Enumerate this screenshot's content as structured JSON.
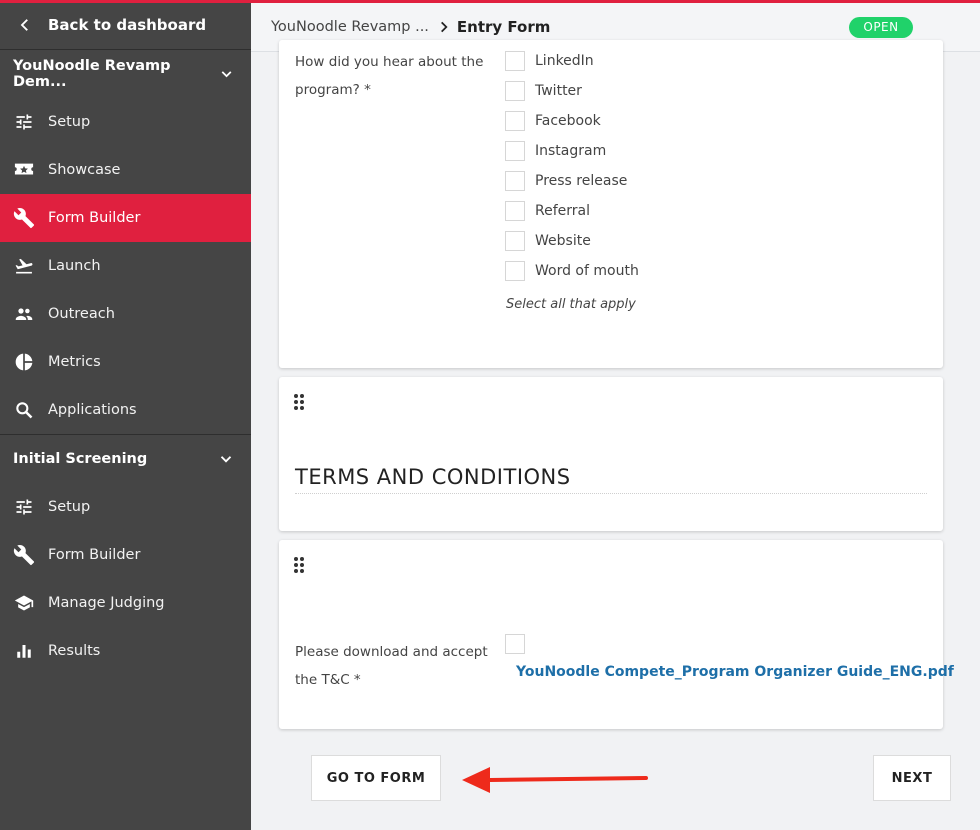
{
  "sidebar": {
    "back_label": "Back to dashboard",
    "program_title": "YouNoodle Revamp Dem...",
    "program_items": [
      {
        "label": "Setup",
        "icon": "tune-icon"
      },
      {
        "label": "Showcase",
        "icon": "showcase-icon"
      },
      {
        "label": "Form Builder",
        "icon": "wrench-icon",
        "active": true
      },
      {
        "label": "Launch",
        "icon": "flight-takeoff-icon"
      },
      {
        "label": "Outreach",
        "icon": "people-icon"
      },
      {
        "label": "Metrics",
        "icon": "pie-chart-icon"
      },
      {
        "label": "Applications",
        "icon": "search-icon"
      }
    ],
    "screening_title": "Initial Screening",
    "screening_items": [
      {
        "label": "Setup",
        "icon": "tune-icon"
      },
      {
        "label": "Form Builder",
        "icon": "wrench-icon"
      },
      {
        "label": "Manage Judging",
        "icon": "school-icon"
      },
      {
        "label": "Results",
        "icon": "bar-chart-icon"
      }
    ]
  },
  "header": {
    "breadcrumb_parent": "YouNoodle Revamp ...",
    "breadcrumb_current": "Entry Form",
    "status_badge": "OPEN"
  },
  "form": {
    "hear_question": "How did you hear about the program? *",
    "hear_options": [
      "LinkedIn",
      "Twitter",
      "Facebook",
      "Instagram",
      "Press release",
      "Referral",
      "Website",
      "Word of mouth"
    ],
    "hear_hint": "Select all that apply",
    "terms_title": "TERMS AND CONDITIONS",
    "tc_question": "Please download and accept the T&C *",
    "tc_file": "YouNoodle Compete_Program Organizer Guide_ENG.pdf"
  },
  "footer": {
    "goto_label": "GO TO FORM",
    "next_label": "NEXT"
  },
  "colors": {
    "accent": "#e0203f",
    "sidebar_bg": "#454545",
    "badge_green": "#20d26a",
    "link_blue": "#1e6fa8",
    "arrow_red": "#ee2a1b"
  }
}
